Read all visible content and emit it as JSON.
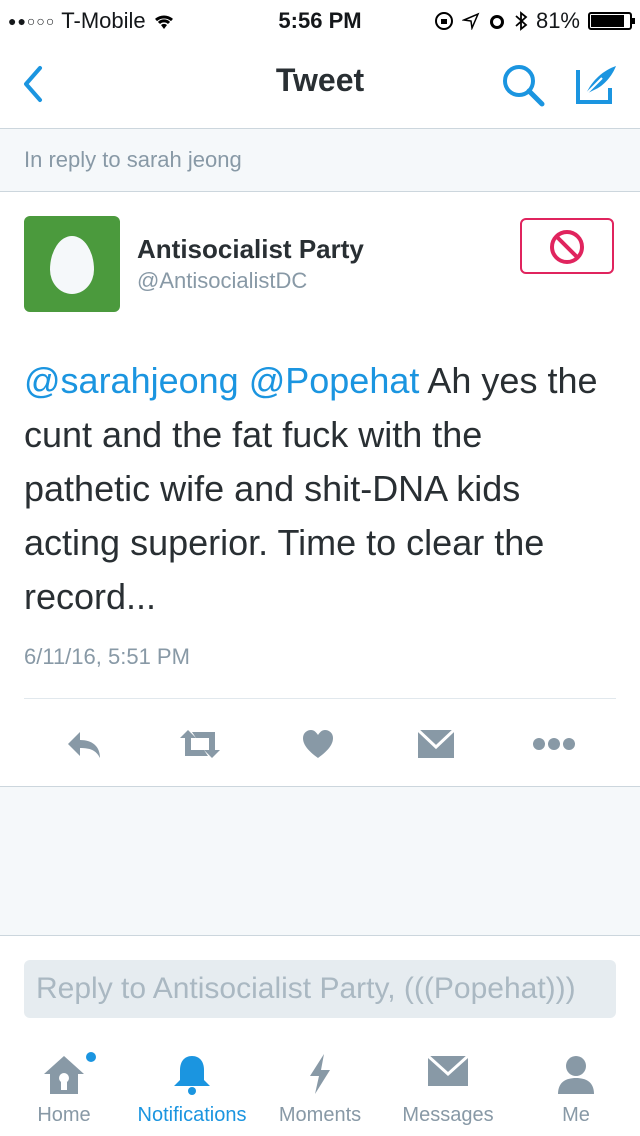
{
  "status_bar": {
    "signal": "●●○○○",
    "carrier": "T-Mobile",
    "time": "5:56 PM",
    "battery": "81%"
  },
  "nav": {
    "title": "Tweet"
  },
  "in_reply": "In reply to sarah jeong",
  "tweet": {
    "name": "Antisocialist Party",
    "handle": "@AntisocialistDC",
    "mention1": "@sarahjeong",
    "mention2": "@Popehat",
    "body": " Ah yes the cunt and the fat fuck with the pathetic wife and shit-DNA kids acting superior.  Time to clear the record...",
    "timestamp": "6/11/16, 5:51 PM"
  },
  "reply": {
    "placeholder": "Reply to Antisocialist Party, (((Popehat)))"
  },
  "tabs": [
    {
      "label": "Home",
      "icon": "home-icon"
    },
    {
      "label": "Notifications",
      "icon": "bell-icon"
    },
    {
      "label": "Moments",
      "icon": "lightning-icon"
    },
    {
      "label": "Messages",
      "icon": "envelope-icon"
    },
    {
      "label": "Me",
      "icon": "person-icon"
    }
  ],
  "colors": {
    "accent": "#1b95e0",
    "block": "#e0245e",
    "avatar_bg": "#4b9a3d",
    "muted": "#8899a6"
  }
}
